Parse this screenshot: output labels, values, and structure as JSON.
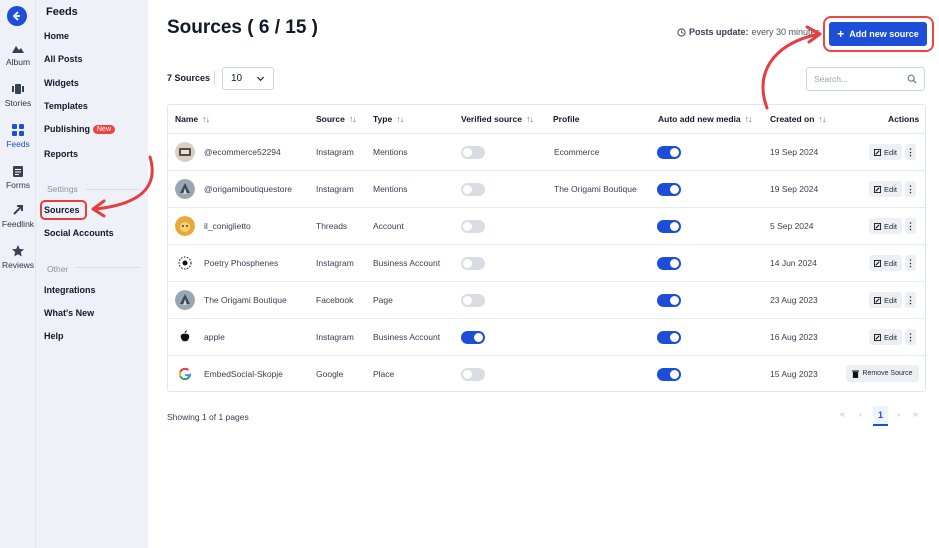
{
  "rail": [
    {
      "label": "Album",
      "icon": "mountain-icon"
    },
    {
      "label": "Stories",
      "icon": "stories-icon"
    },
    {
      "label": "Feeds",
      "icon": "grid-icon"
    },
    {
      "label": "Forms",
      "icon": "clipboard-icon"
    },
    {
      "label": "Feedlink",
      "icon": "link-icon"
    },
    {
      "label": "Reviews",
      "icon": "star-icon"
    }
  ],
  "sidebar": {
    "title": "Feeds",
    "items": [
      "Home",
      "All Posts",
      "Widgets",
      "Templates",
      "Publishing",
      "Reports"
    ],
    "publishing_badge": "New",
    "settings_label": "Settings",
    "settings_items": [
      "Sources",
      "Social Accounts"
    ],
    "other_label": "Other",
    "other_items": [
      "Integrations",
      "What's New",
      "Help"
    ]
  },
  "header": {
    "title": "Sources ( 6 / 15 )",
    "posts_update_label": "Posts update:",
    "posts_update_value": "every 30 minutes",
    "add_button": "Add new source"
  },
  "toolbar": {
    "count": "7 Sources",
    "per_page": "10",
    "search_placeholder": "Search..."
  },
  "table": {
    "columns": [
      "Name",
      "Source",
      "Type",
      "Verified source",
      "Profile",
      "Auto add new media",
      "Created on",
      "Actions"
    ],
    "rows": [
      {
        "name": "@ecommerce52294",
        "source": "Instagram",
        "type": "Mentions",
        "verified": false,
        "profile": "Ecommerce",
        "auto": true,
        "created": "19 Sep 2024",
        "action": "Edit",
        "avatar": "ecom"
      },
      {
        "name": "@origamiboutiquestore",
        "source": "Instagram",
        "type": "Mentions",
        "verified": false,
        "profile": "The Origami Boutique",
        "auto": true,
        "created": "19 Sep 2024",
        "action": "Edit",
        "avatar": "origami"
      },
      {
        "name": "il_coniglietto",
        "source": "Threads",
        "type": "Account",
        "verified": false,
        "profile": "",
        "auto": true,
        "created": "5 Sep 2024",
        "action": "Edit",
        "avatar": "bunny"
      },
      {
        "name": "Poetry Phosphenes",
        "source": "Instagram",
        "type": "Business Account",
        "verified": false,
        "profile": "",
        "auto": true,
        "created": "14 Jun 2024",
        "action": "Edit",
        "avatar": "poetry"
      },
      {
        "name": "The Origami Boutique",
        "source": "Facebook",
        "type": "Page",
        "verified": false,
        "profile": "",
        "auto": true,
        "created": "23 Aug 2023",
        "action": "Edit",
        "avatar": "origami"
      },
      {
        "name": "apple",
        "source": "Instagram",
        "type": "Business Account",
        "verified": true,
        "profile": "",
        "auto": true,
        "created": "16 Aug 2023",
        "action": "Edit",
        "avatar": "apple"
      },
      {
        "name": "EmbedSocial-Skopje",
        "source": "Google",
        "type": "Place",
        "verified": false,
        "profile": "",
        "auto": true,
        "created": "15 Aug 2023",
        "action": "Remove Source",
        "avatar": "google"
      }
    ]
  },
  "footer": {
    "showing": "Showing 1 of 1 pages",
    "current_page": "1"
  },
  "colors": {
    "accent": "#1d4ed8",
    "highlight": "#ef4444",
    "sidebar_bg": "#eef1f8"
  }
}
